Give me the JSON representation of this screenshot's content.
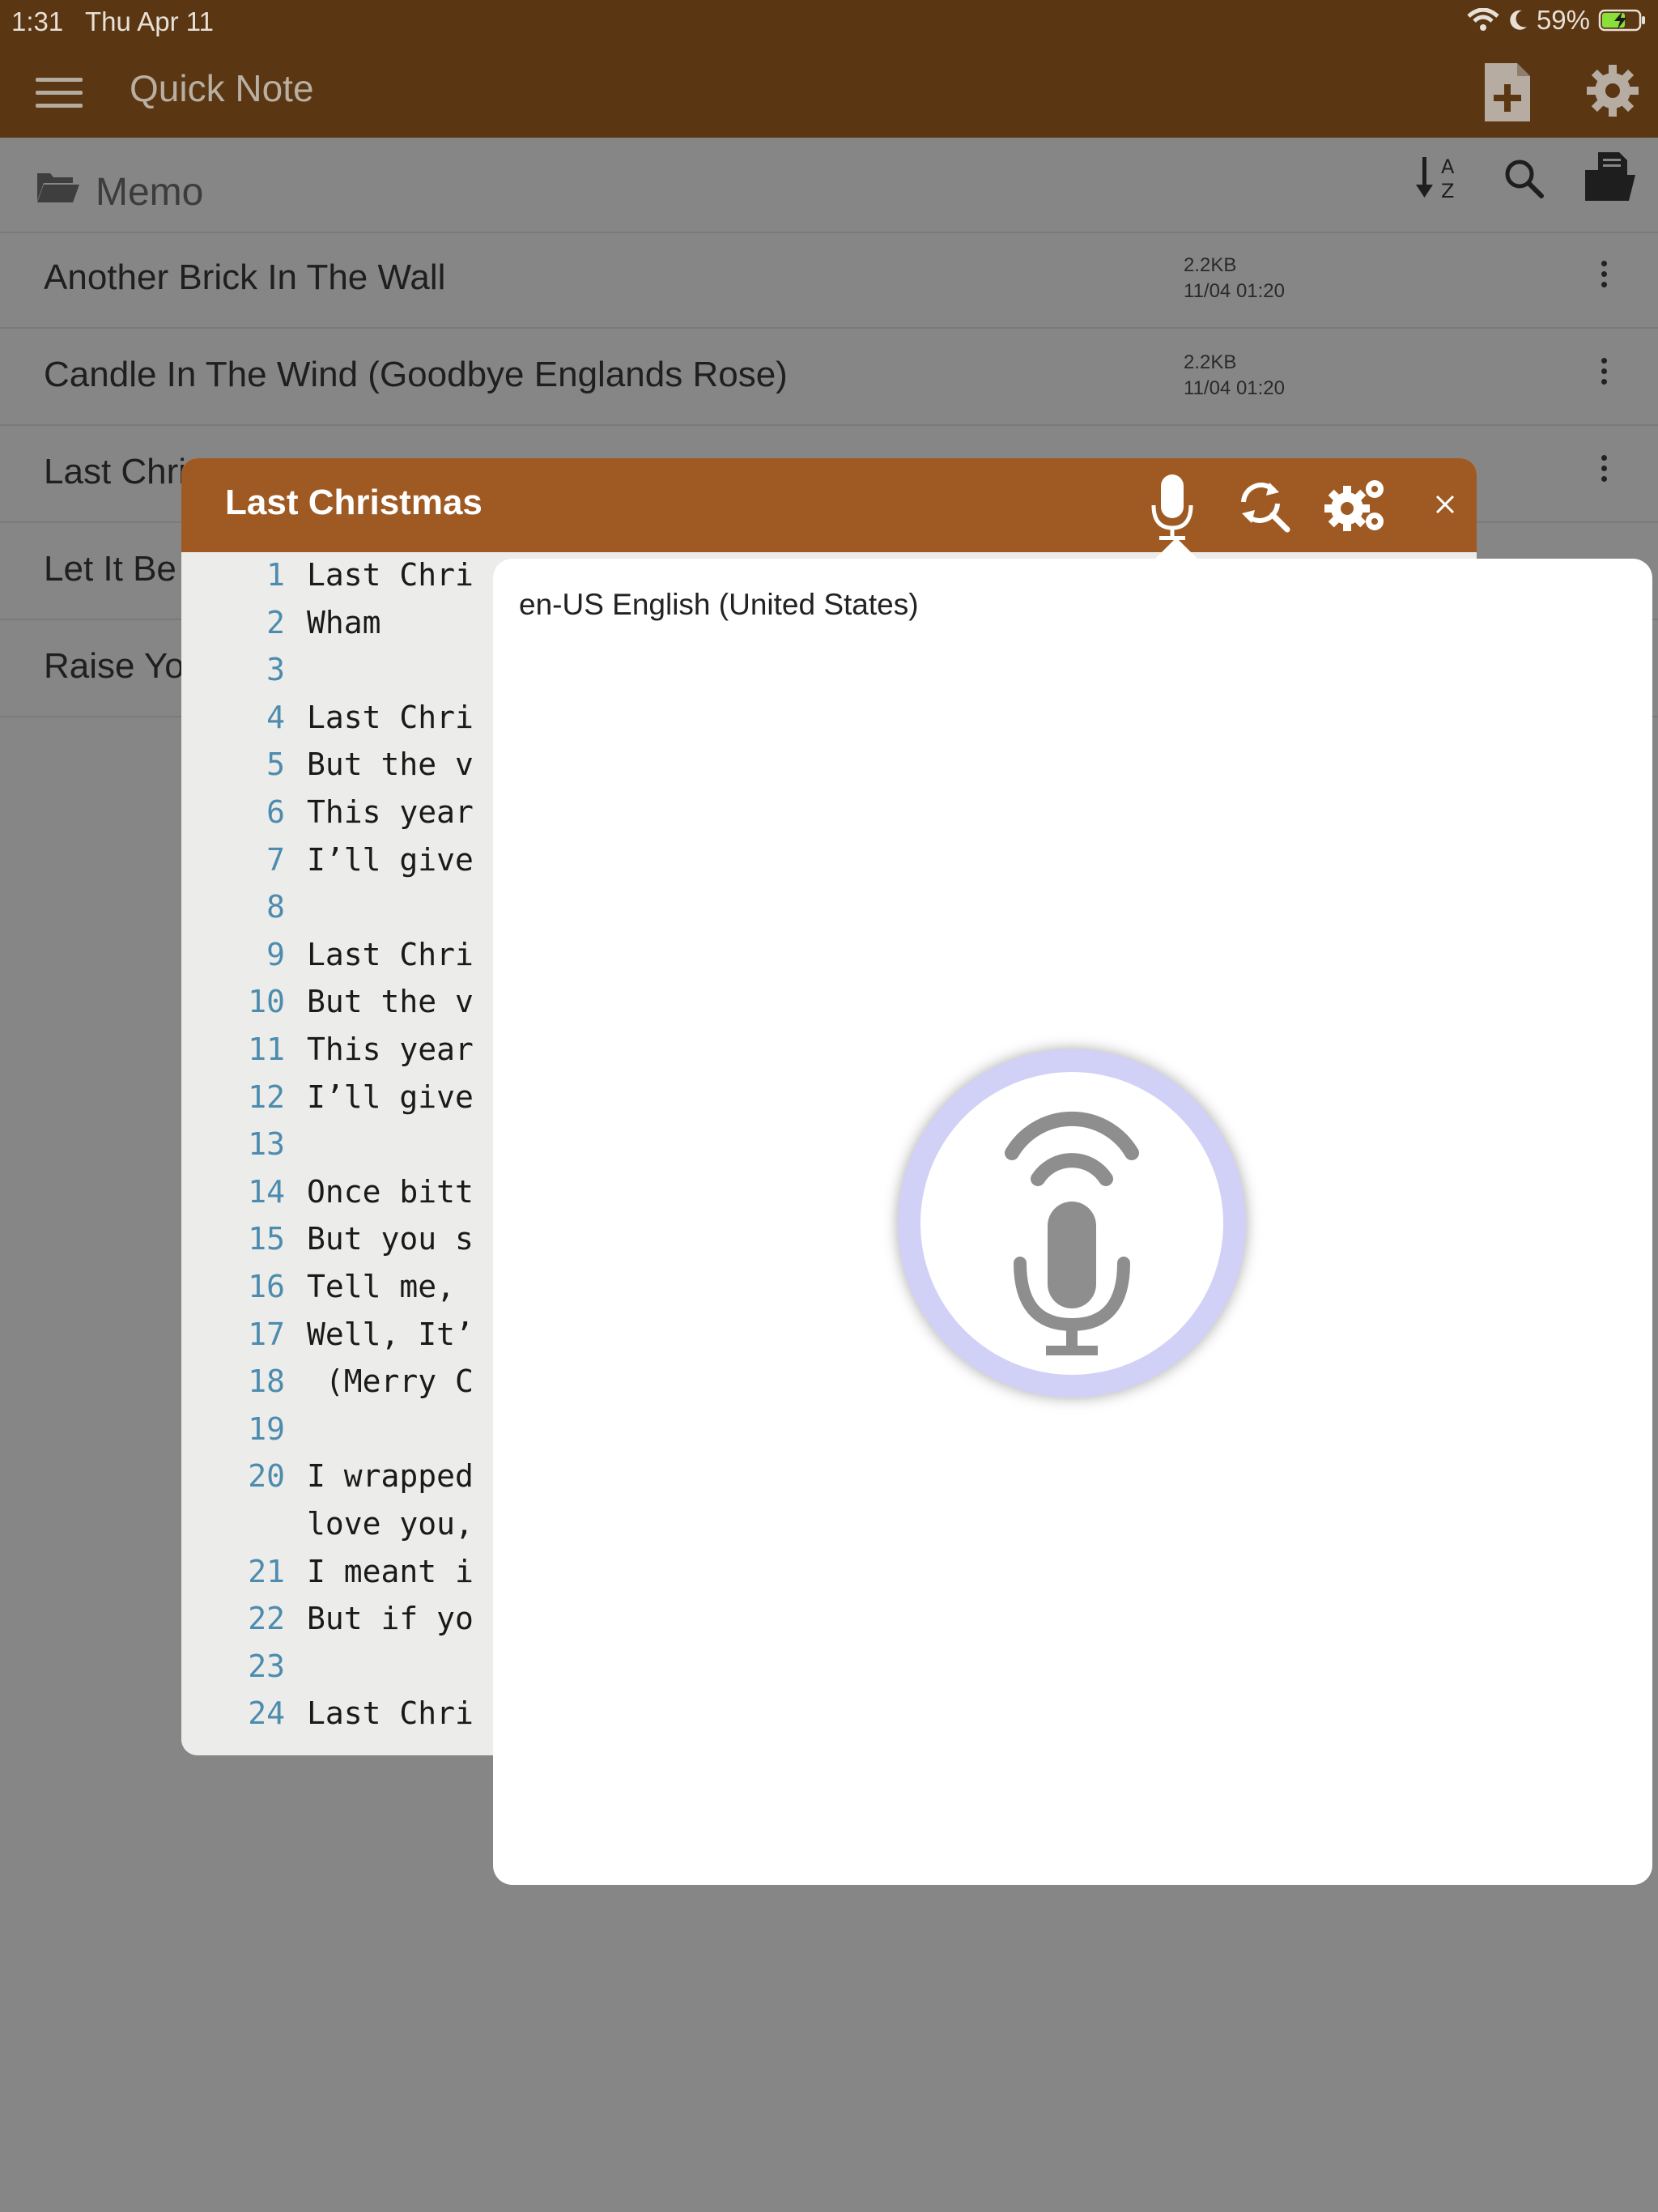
{
  "status_bar": {
    "time": "1:31",
    "date": "Thu Apr 11",
    "battery": "59%"
  },
  "app_bar": {
    "title": "Quick Note"
  },
  "folder": {
    "title": "Memo"
  },
  "notes": [
    {
      "title": "Another Brick In The Wall",
      "size": "2.2KB",
      "date": "11/04 01:20"
    },
    {
      "title": "Candle In The Wind (Goodbye Englands Rose)",
      "size": "2.2KB",
      "date": "11/04 01:20"
    },
    {
      "title": "Last Chri",
      "size": "",
      "date": ""
    },
    {
      "title": "Let It Be",
      "size": "",
      "date": ""
    },
    {
      "title": "Raise Yo",
      "size": "",
      "date": ""
    }
  ],
  "editor": {
    "title": "Last Christmas",
    "lines": [
      {
        "n": "1",
        "t": "Last Chri"
      },
      {
        "n": "2",
        "t": "Wham"
      },
      {
        "n": "3",
        "t": ""
      },
      {
        "n": "4",
        "t": "Last Chri"
      },
      {
        "n": "5",
        "t": "But the v"
      },
      {
        "n": "6",
        "t": "This year"
      },
      {
        "n": "7",
        "t": "I’ll give"
      },
      {
        "n": "8",
        "t": ""
      },
      {
        "n": "9",
        "t": "Last Chri"
      },
      {
        "n": "10",
        "t": "But the v"
      },
      {
        "n": "11",
        "t": "This year"
      },
      {
        "n": "12",
        "t": "I’ll give"
      },
      {
        "n": "13",
        "t": ""
      },
      {
        "n": "14",
        "t": "Once bitt"
      },
      {
        "n": "15",
        "t": "But you s"
      },
      {
        "n": "16",
        "t": "Tell me,"
      },
      {
        "n": "17",
        "t": "Well, It’"
      },
      {
        "n": "18",
        "t": " (Merry C"
      },
      {
        "n": "19",
        "t": ""
      },
      {
        "n": "20",
        "t": "I wrapped"
      },
      {
        "n": "",
        "t": "love you,"
      },
      {
        "n": "21",
        "t": "I meant i"
      },
      {
        "n": "22",
        "t": "But if yo"
      },
      {
        "n": "23",
        "t": ""
      },
      {
        "n": "24",
        "t": "Last Chri"
      }
    ]
  },
  "speech_popover": {
    "language": "en-US English (United States)"
  },
  "colors": {
    "app_bar": "#5a3612",
    "editor_header": "#9e5a22",
    "overlay": "#868686",
    "line_number": "#4d8cae",
    "mic_ring": "#d1d1f8"
  }
}
